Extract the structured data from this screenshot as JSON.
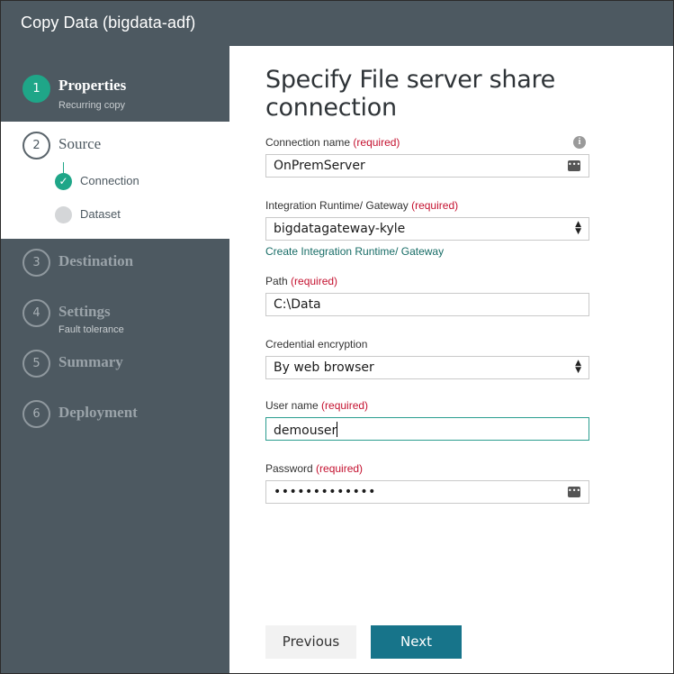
{
  "window": {
    "title": "Copy Data (bigdata-adf)"
  },
  "steps": [
    {
      "number": "1",
      "name": "Properties",
      "subtitle": "Recurring copy"
    },
    {
      "number": "2",
      "name": "Source",
      "substeps": [
        {
          "label": "Connection",
          "check": "✓"
        },
        {
          "label": "Dataset"
        }
      ]
    },
    {
      "number": "3",
      "name": "Destination"
    },
    {
      "number": "4",
      "name": "Settings",
      "subtitle": "Fault tolerance"
    },
    {
      "number": "5",
      "name": "Summary"
    },
    {
      "number": "6",
      "name": "Deployment"
    }
  ],
  "form": {
    "heading": "Specify File server share connection",
    "required_tag": "(required)",
    "connection_name": {
      "label": "Connection name",
      "value": "OnPremServer",
      "info": "i",
      "icon": "keyboard-icon"
    },
    "runtime": {
      "label": "Integration Runtime/ Gateway",
      "value": "bigdatagateway-kyle",
      "link": "Create Integration Runtime/ Gateway"
    },
    "path": {
      "label": "Path",
      "value": "C:\\Data"
    },
    "credential": {
      "label": "Credential encryption",
      "value": "By web browser"
    },
    "username": {
      "label": "User name",
      "value": "demouser"
    },
    "password": {
      "label": "Password",
      "value": "•••••••••••••",
      "icon": "keyboard-icon"
    }
  },
  "buttons": {
    "previous": "Previous",
    "next": "Next"
  },
  "colors": {
    "sidebar": "#4d5961",
    "accent": "#1fa688",
    "primary_button": "#17748a",
    "required": "#c4112f"
  }
}
